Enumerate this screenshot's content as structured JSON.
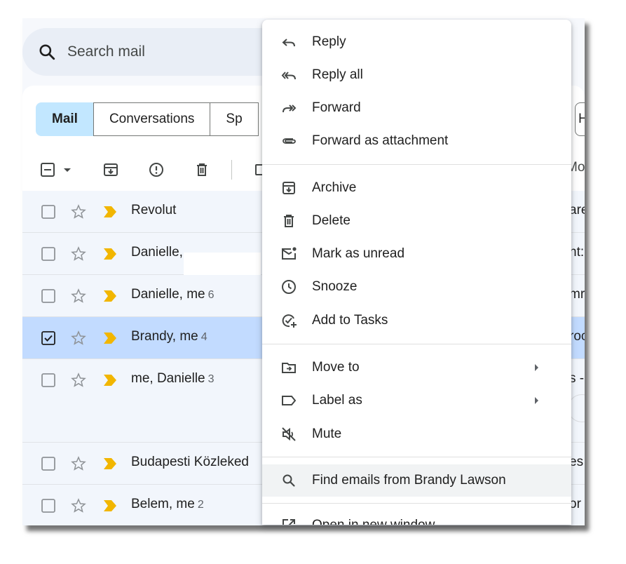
{
  "search": {
    "placeholder": "Search mail"
  },
  "chips": [
    {
      "label": "Mail"
    },
    {
      "label": "Conversations"
    },
    {
      "label": "Sp"
    },
    {
      "label": "H"
    }
  ],
  "toolbar": {
    "more_text": "Mo"
  },
  "rows": [
    {
      "sender": "Revolut",
      "count": "",
      "tail": "are",
      "selected": false
    },
    {
      "sender": "Danielle, ",
      "count": "",
      "tail": "nt:",
      "selected": false
    },
    {
      "sender": "Danielle, me",
      "count": "6",
      "tail": "mr",
      "selected": false
    },
    {
      "sender": "Brandy, me",
      "count": "4",
      "tail": "roc",
      "selected": true
    },
    {
      "sender": "me, Danielle",
      "count": "3",
      "tail": "s -",
      "selected": false
    },
    {
      "sender": "Budapesti Közleked",
      "count": "",
      "tail": "es",
      "selected": false
    },
    {
      "sender": "Belem, me",
      "count": "2",
      "tail": "or",
      "selected": false
    }
  ],
  "menu": {
    "items": [
      {
        "label": "Reply",
        "icon": "reply-icon"
      },
      {
        "label": "Reply all",
        "icon": "reply-all-icon"
      },
      {
        "label": "Forward",
        "icon": "forward-icon"
      },
      {
        "label": "Forward as attachment",
        "icon": "attachment-icon"
      },
      {
        "label": "Archive",
        "icon": "archive-icon"
      },
      {
        "label": "Delete",
        "icon": "trash-icon"
      },
      {
        "label": "Mark as unread",
        "icon": "mark-unread-icon"
      },
      {
        "label": "Snooze",
        "icon": "clock-icon"
      },
      {
        "label": "Add to Tasks",
        "icon": "add-task-icon"
      },
      {
        "label": "Move to",
        "icon": "move-to-icon"
      },
      {
        "label": "Label as",
        "icon": "label-icon"
      },
      {
        "label": "Mute",
        "icon": "mute-icon"
      },
      {
        "label": "Find emails from Brandy Lawson",
        "icon": "search-icon"
      },
      {
        "label": "Open in new window",
        "icon": "open-new-window-icon"
      }
    ]
  },
  "colors": {
    "selected_row": "#c2dbff",
    "active_chip": "#c2e7ff",
    "importance_marker": "#f2b600",
    "menu_hover": "#f1f3f4"
  }
}
